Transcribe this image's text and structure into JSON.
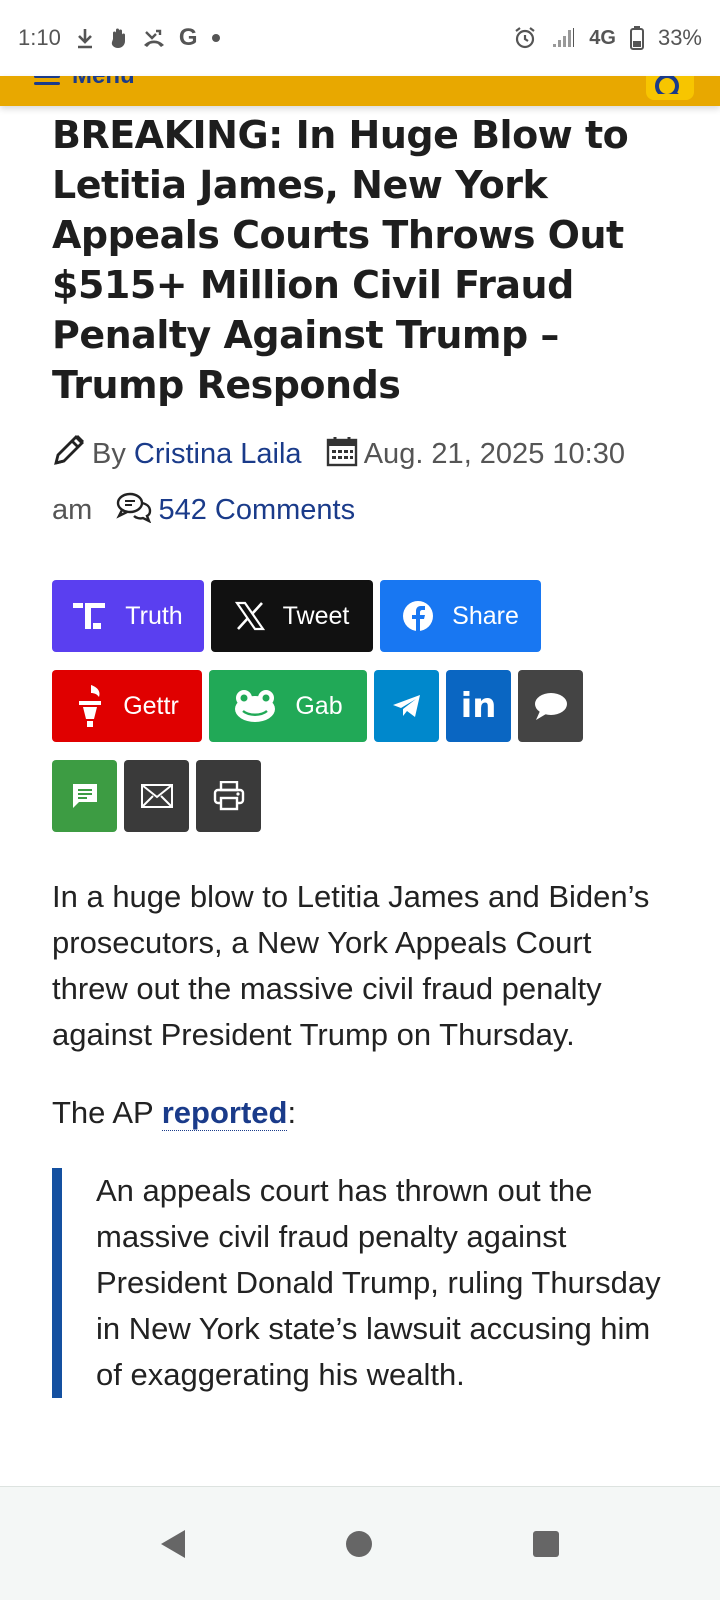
{
  "status_bar": {
    "time": "1:10",
    "network": "4G",
    "battery": "33%"
  },
  "nav": {
    "menu_label": "Menu"
  },
  "article": {
    "headline": "BREAKING: In Huge Blow to Letitia James, New York Appeals Courts Throws Out $515+ Million Civil Fraud Penalty Against Trump – Trump Responds",
    "by_label": "By",
    "author": "Cristina Laila",
    "date": "Aug. 21, 2025 10:30 am",
    "comments": "542 Comments"
  },
  "share": {
    "truth": "Truth",
    "tweet": "Tweet",
    "facebook": "Share",
    "gettr": "Gettr",
    "gab": "Gab"
  },
  "body": {
    "paragraph1": "In a huge blow to Letitia James and Biden’s prosecutors, a New York Appeals Court threw out the massive civil fraud penalty against President Trump on Thursday.",
    "ap_prefix": "The AP ",
    "ap_link": "reported",
    "ap_suffix": ":",
    "quote": "An appeals court has thrown out the massive civil fraud penalty against President Donald Trump, ruling Thursday in New York state’s lawsuit accusing him of exaggerating his wealth."
  },
  "colors": {
    "nav_bg": "#e8a800",
    "link": "#1a3b8a",
    "quote_border": "#1450a0"
  }
}
